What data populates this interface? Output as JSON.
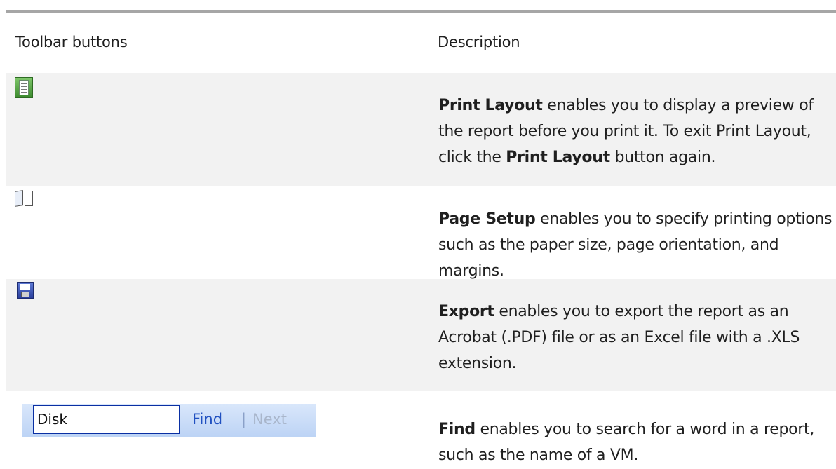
{
  "header": {
    "col_buttons": "Toolbar buttons",
    "col_description": "Description"
  },
  "rows": [
    {
      "icon": "print-layout-icon",
      "bold": "Print Layout",
      "text1": " enables you to display a preview of the report before you print it.  To exit Print Layout, click the ",
      "bold2": "Print Layout",
      "text2": " button again."
    },
    {
      "icon": "page-setup-icon",
      "bold": "Page Setup",
      "text1": " enables you to specify printing options such as the paper size, page orientation, and margins."
    },
    {
      "icon": "save-icon",
      "bold": "Export",
      "text1": " enables you to export the report as an Acrobat (.PDF) file or as an Excel file with a .XLS extension."
    },
    {
      "icon": "find-toolbar",
      "find_value": "Disk",
      "find_label": "Find",
      "separator": "|",
      "next_label": "Next",
      "bold": "Find",
      "text1": " enables you to search for a word in a report, such as the name of a VM."
    }
  ]
}
